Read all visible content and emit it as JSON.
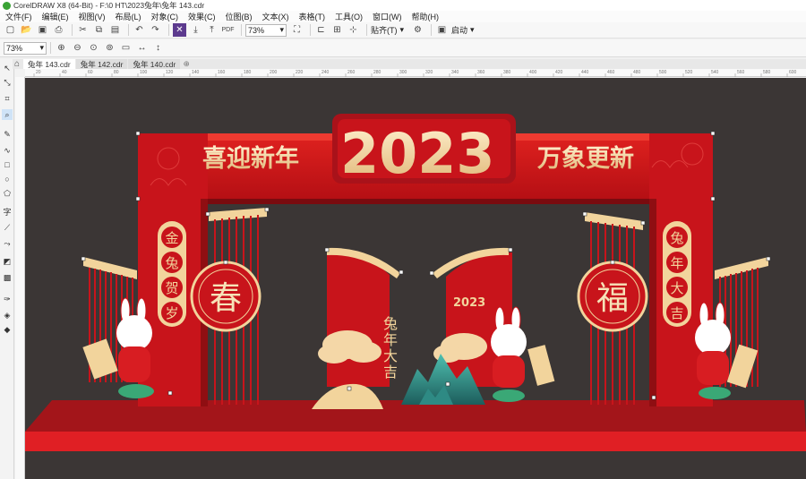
{
  "window": {
    "title": "CorelDRAW X8 (64-Bit) - F:\\0 HT\\2023兔年\\兔年 143.cdr"
  },
  "menu": [
    "文件(F)",
    "编辑(E)",
    "视图(V)",
    "布局(L)",
    "对象(C)",
    "效果(C)",
    "位图(B)",
    "文本(X)",
    "表格(T)",
    "工具(O)",
    "窗口(W)",
    "帮助(H)"
  ],
  "toolbar": {
    "zoom": "73%",
    "snap": "贴齐(T)",
    "launch": "启动"
  },
  "toolbar2": {
    "zoom": "73%"
  },
  "tabs": [
    {
      "label": "兔年 143.cdr",
      "active": true
    },
    {
      "label": "兔年 142.cdr",
      "active": false
    },
    {
      "label": "兔年 140.cdr",
      "active": false
    }
  ],
  "ruler": {
    "ticks": [
      "20",
      "40",
      "60",
      "80",
      "100",
      "120",
      "140",
      "160",
      "180",
      "200",
      "220",
      "240",
      "260",
      "280",
      "300",
      "320",
      "340",
      "360",
      "380",
      "400",
      "420",
      "440",
      "460",
      "480",
      "500",
      "520",
      "540",
      "560",
      "580",
      "600"
    ]
  },
  "design": {
    "year": "2023",
    "slogan_left": "喜迎新年",
    "slogan_right": "万象更新",
    "banner_left": [
      "金",
      "兔",
      "贺",
      "岁"
    ],
    "banner_right": [
      "兔",
      "年",
      "大",
      "吉"
    ],
    "circle_left": "春",
    "circle_right": "福",
    "center_left_text": [
      "兔",
      "年",
      "大",
      "吉"
    ],
    "center_right_year": "2023",
    "colors": {
      "red": "#d4151c",
      "dark_red": "#9e0f14",
      "gold": "#f2d49c",
      "bg": "#3b3635"
    }
  }
}
